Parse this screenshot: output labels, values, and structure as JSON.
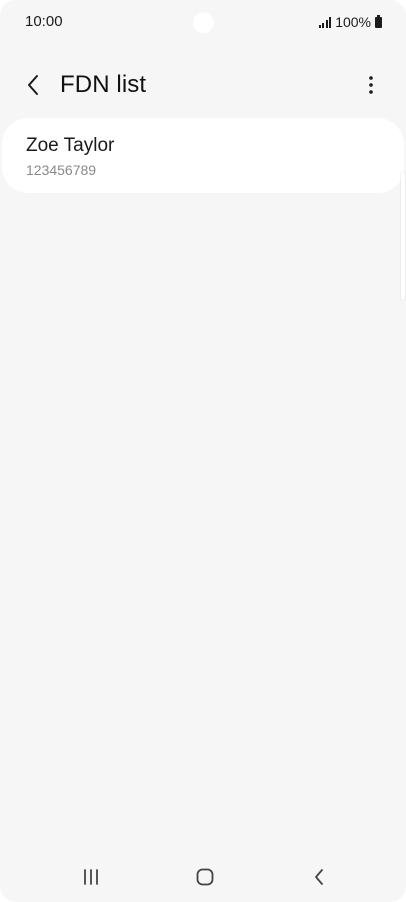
{
  "status_bar": {
    "time": "10:00",
    "battery": "100%",
    "icons": [
      "signal-icon",
      "battery-icon"
    ]
  },
  "header": {
    "title": "FDN list",
    "back_icon": "chevron-left-icon",
    "menu_icon": "more-vertical-icon"
  },
  "contacts": [
    {
      "name": "Zoe Taylor",
      "number": "123456789"
    }
  ],
  "nav_bar": {
    "icons": [
      "recents-icon",
      "home-icon",
      "back-icon"
    ]
  },
  "colors": {
    "background": "#f6f6f6",
    "card": "#ffffff",
    "text_primary": "#1a1a1a",
    "text_secondary": "#8a8a8a"
  }
}
